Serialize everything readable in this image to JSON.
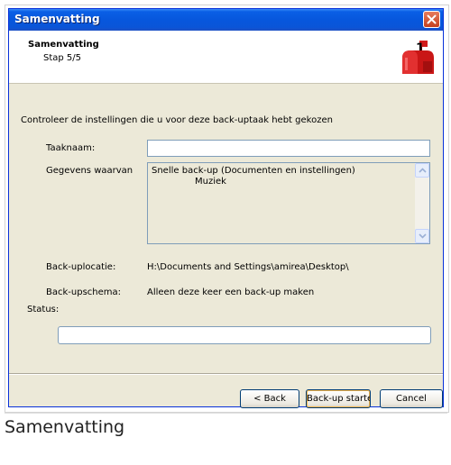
{
  "window": {
    "title": "Samenvatting"
  },
  "header": {
    "title": "Samenvatting",
    "step": "Stap 5/5",
    "icon": "mailbox-icon"
  },
  "main": {
    "instruction": "Controleer de instellingen die u voor deze back-uptaak hebt gekozen",
    "task_name_label": "Taaknaam:",
    "task_name_value": "",
    "data_label": "Gegevens waarvan",
    "data_items": [
      "Snelle back-up (Documenten en instellingen)",
      "Muziek"
    ],
    "location_label": "Back-uplocatie:",
    "location_value": "H:\\Documents and Settings\\amirea\\Desktop\\",
    "schedule_label": "Back-upschema:",
    "schedule_value": "Alleen deze keer een back-up maken",
    "status_label": "Status:",
    "status_value": ""
  },
  "buttons": {
    "back": "< Back",
    "start": "Back-up starten",
    "cancel": "Cancel"
  },
  "caption": "Samenvatting",
  "colors": {
    "titlebar": "#0757dd",
    "window_bg": "#ece9d8",
    "mailbox_red": "#d11a1a"
  }
}
